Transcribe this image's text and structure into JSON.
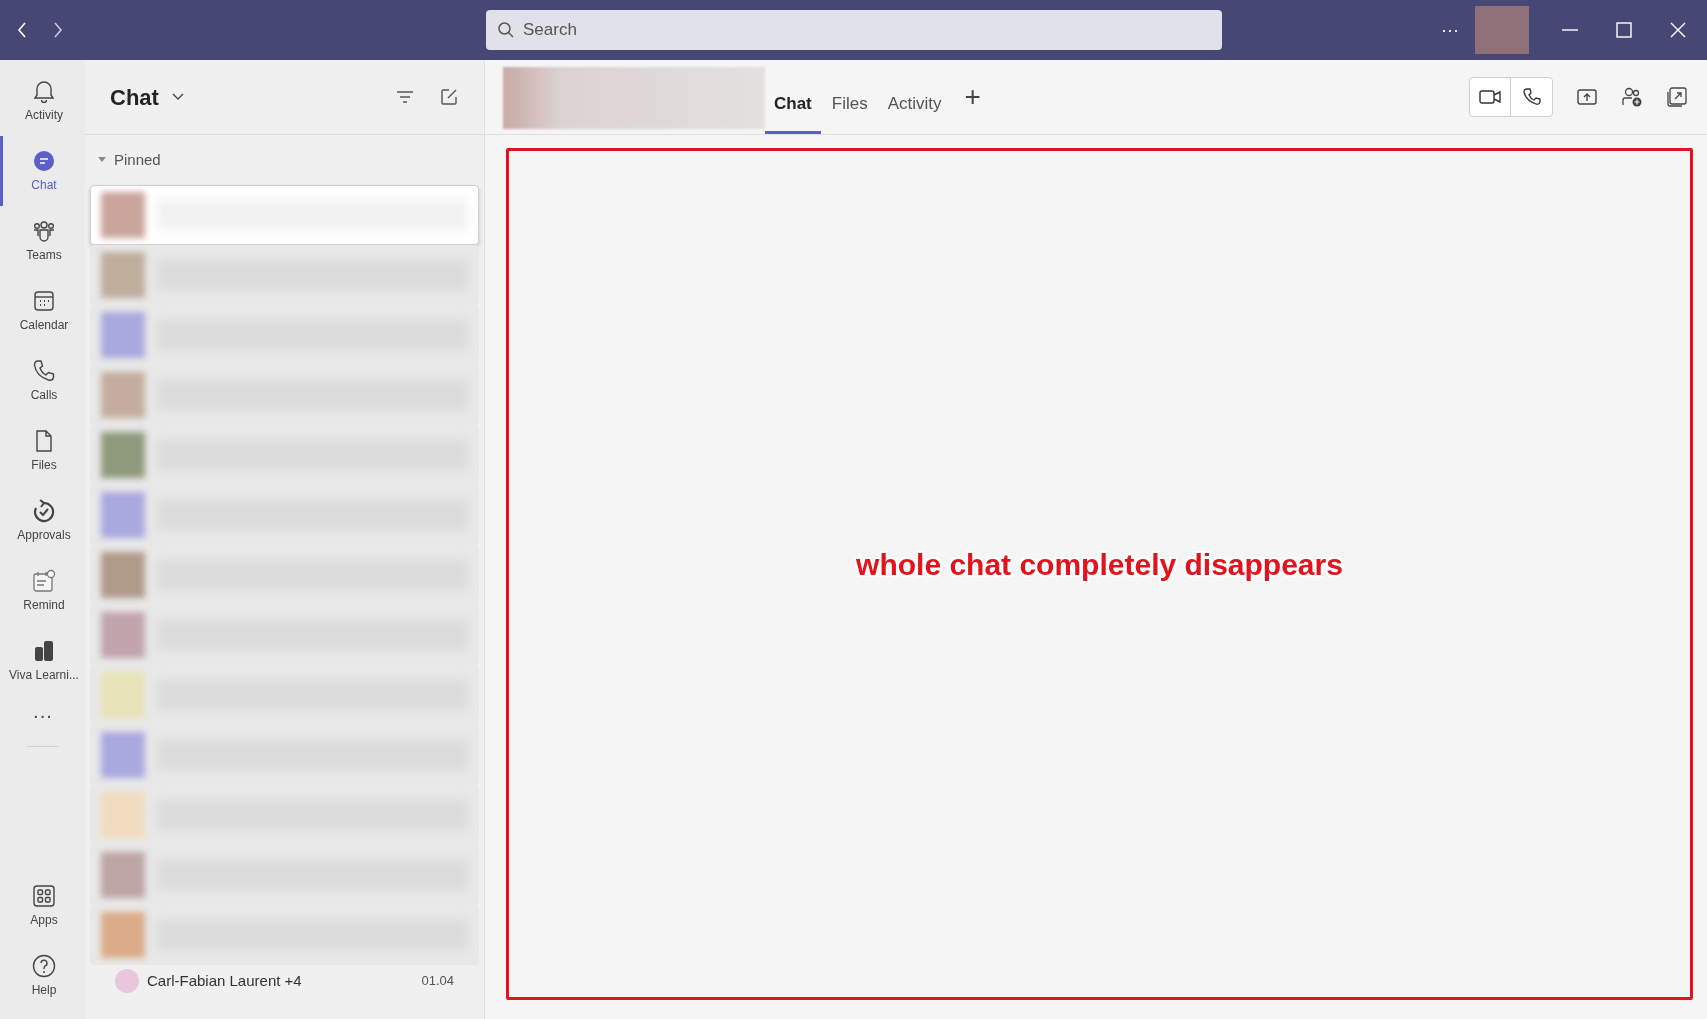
{
  "title_bar": {
    "search": {
      "placeholder": "Search"
    },
    "more": "···"
  },
  "app_bar": {
    "items": [
      {
        "label": "Activity",
        "kind": "bell",
        "selected": false
      },
      {
        "label": "Chat",
        "kind": "chat",
        "selected": true
      },
      {
        "label": "Teams",
        "kind": "teams",
        "selected": false
      },
      {
        "label": "Calendar",
        "kind": "calendar",
        "selected": false
      },
      {
        "label": "Calls",
        "kind": "phone",
        "selected": false
      },
      {
        "label": "Files",
        "kind": "file",
        "selected": false
      },
      {
        "label": "Approvals",
        "kind": "approvals",
        "selected": false
      },
      {
        "label": "Remind",
        "kind": "remind",
        "selected": false
      },
      {
        "label": "Viva Learni...",
        "kind": "viva",
        "selected": false
      }
    ],
    "more": "···",
    "bottom_items": [
      {
        "label": "Apps",
        "kind": "apps",
        "selected": false
      },
      {
        "label": "Help",
        "kind": "help",
        "selected": false
      }
    ]
  },
  "chat_list": {
    "title": "Chat",
    "section": "Pinned",
    "rows": [
      {
        "selected": true,
        "color": "#c9a59c"
      },
      {
        "selected": false,
        "color": "#bfae9c"
      },
      {
        "selected": false,
        "color": "#a9a9e0"
      },
      {
        "selected": false,
        "color": "#c4ad9e"
      },
      {
        "selected": false,
        "color": "#8f9a7c"
      },
      {
        "selected": false,
        "color": "#a9a9e0"
      },
      {
        "selected": false,
        "color": "#b09a8a"
      },
      {
        "selected": false,
        "color": "#c2a4ad"
      },
      {
        "selected": false,
        "color": "#e8e3b8"
      },
      {
        "selected": false,
        "color": "#a9a9e0"
      },
      {
        "selected": false,
        "color": "#f1dcc0"
      },
      {
        "selected": false,
        "color": "#bda6a4"
      },
      {
        "selected": false,
        "color": "#dcab88"
      }
    ],
    "last_row": {
      "name": "Carl-Fabian Laurent +4",
      "time": "01.04"
    }
  },
  "conversation": {
    "tabs": [
      {
        "label": "Chat",
        "selected": true
      },
      {
        "label": "Files",
        "selected": false
      },
      {
        "label": "Activity",
        "selected": false
      }
    ],
    "add_tab": "+",
    "annotation": "whole chat completely disappears"
  }
}
